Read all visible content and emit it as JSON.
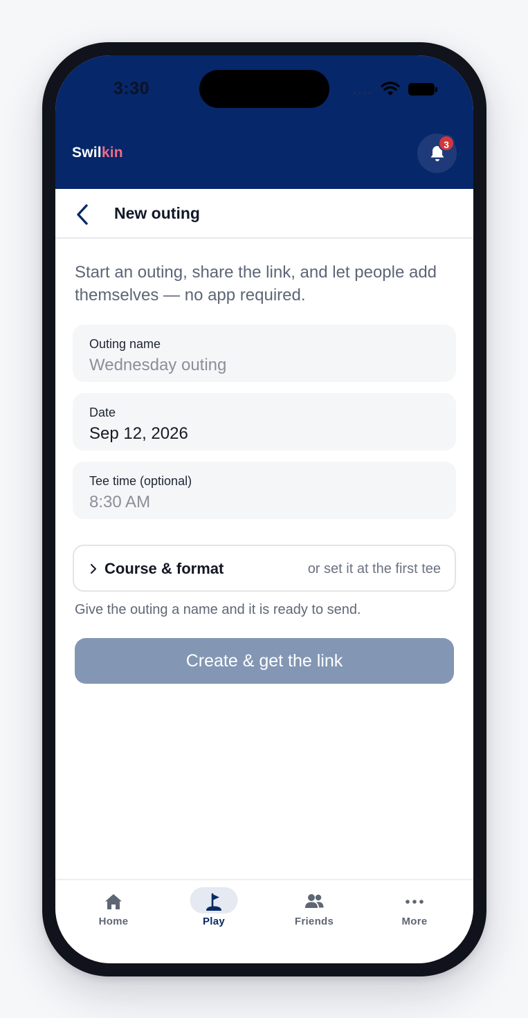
{
  "status": {
    "time": "3:30"
  },
  "header": {
    "brand_main": "Swil",
    "brand_accent": "kin",
    "notification_count": "3"
  },
  "nav": {
    "title": "New outing"
  },
  "intro": "Start an outing, share the link, and let people add themselves — no app required.",
  "form": {
    "outing_name": {
      "label": "Outing name",
      "placeholder": "Wednesday outing"
    },
    "date": {
      "label": "Date",
      "value": "Sep 12, 2026"
    },
    "tee_time": {
      "label": "Tee time (optional)",
      "placeholder": "8:30 AM"
    }
  },
  "course": {
    "label": "Course & format",
    "hint": "or set it at the first tee"
  },
  "hint": "Give the outing a name and it is ready to send.",
  "cta": {
    "label": "Create & get the link"
  },
  "tabs": [
    {
      "label": "Home",
      "icon": "home-icon"
    },
    {
      "label": "Play",
      "icon": "flag-icon",
      "active": true
    },
    {
      "label": "Friends",
      "icon": "friends-icon"
    },
    {
      "label": "More",
      "icon": "more-icon"
    }
  ],
  "colors": {
    "primary": "#062769",
    "accent": "#ef6b8a",
    "badge": "#d2373c",
    "cta_disabled": "#8396b3"
  }
}
